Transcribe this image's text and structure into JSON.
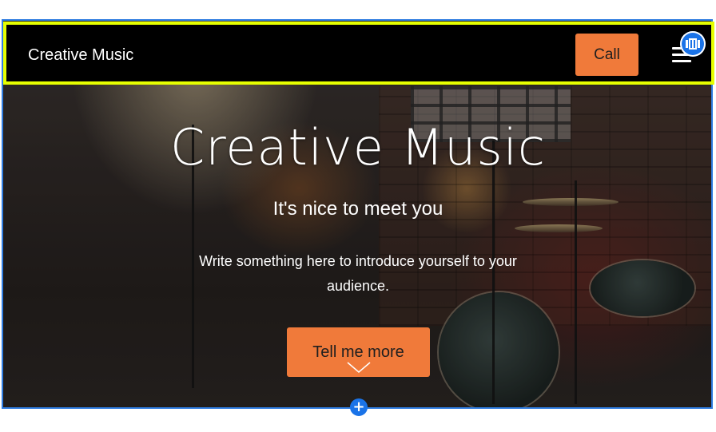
{
  "navbar": {
    "brand": "Creative Music",
    "call_label": "Call",
    "menu_icon": "hamburger-icon",
    "edit_icon": "section-edit-icon"
  },
  "hero": {
    "title": "Creative Music",
    "subtitle": "It's nice to meet you",
    "intro_text": "Write something here to introduce yourself to your audience.",
    "cta_label": "Tell me more",
    "scroll_icon": "chevron-down-icon",
    "add_section_label": "+"
  },
  "colors": {
    "accent": "#f07a3a",
    "navbar_bg": "#000000",
    "selection_outline": "#e6ff00",
    "editor_blue": "#1a73e8"
  }
}
